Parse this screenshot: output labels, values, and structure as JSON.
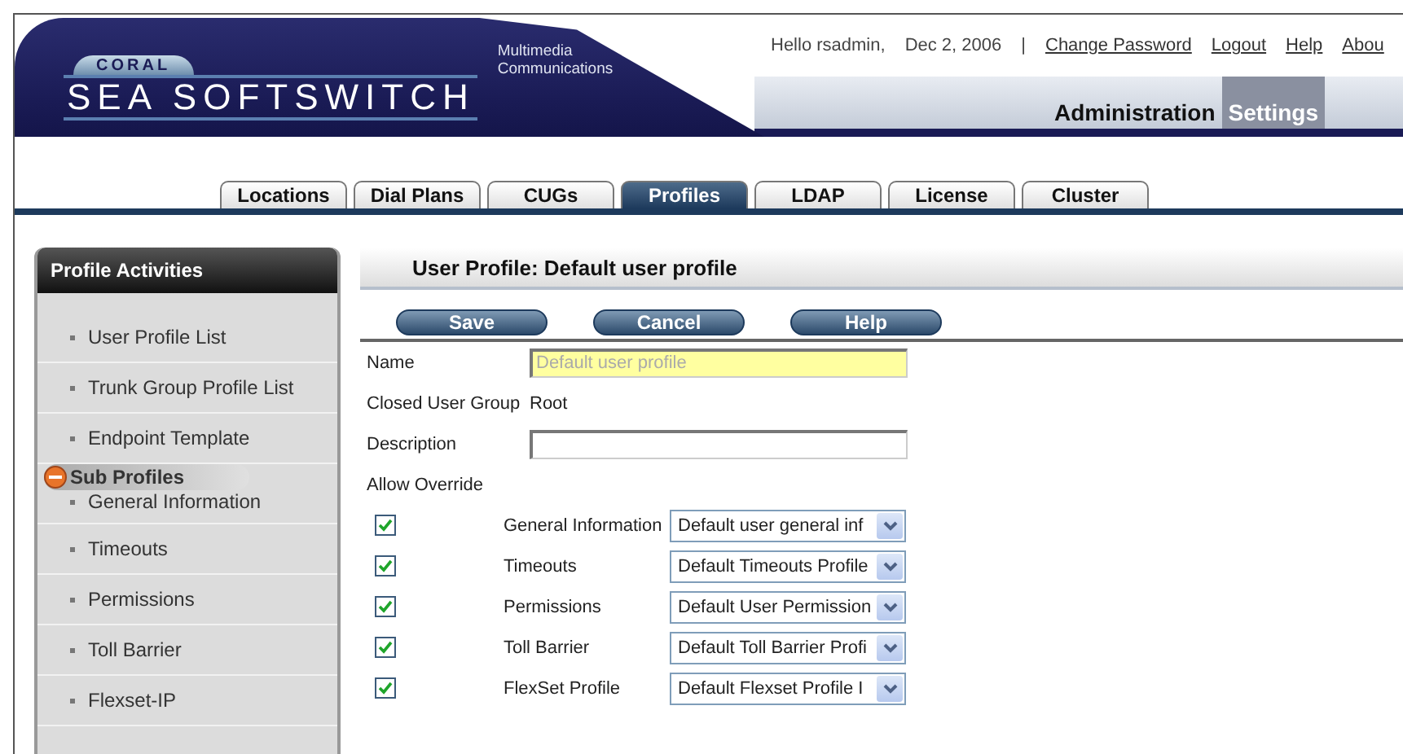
{
  "header": {
    "logo_top": "CORAL",
    "logo_main": "SEA SOFTSWITCH",
    "logo_sub": [
      "Multimedia",
      "Communications"
    ],
    "greeting": "Hello rsadmin,",
    "date": "Dec 2, 2006",
    "separator": "|",
    "links": [
      "Change Password",
      "Logout",
      "Help",
      "Abou"
    ],
    "nav": [
      {
        "label": "Administration",
        "selected": false
      },
      {
        "label": "Settings",
        "selected": true
      }
    ]
  },
  "tabs": [
    {
      "label": "Locations",
      "selected": false
    },
    {
      "label": "Dial Plans",
      "selected": false
    },
    {
      "label": "CUGs",
      "selected": false
    },
    {
      "label": "Profiles",
      "selected": true
    },
    {
      "label": "LDAP",
      "selected": false
    },
    {
      "label": "License",
      "selected": false
    },
    {
      "label": "Cluster",
      "selected": false
    }
  ],
  "sidebar": {
    "title": "Profile Activities",
    "items": [
      "User Profile List",
      "Trunk Group Profile List",
      "Endpoint Template"
    ],
    "sub_title": "Sub Profiles",
    "expanded": true,
    "sub_items": [
      "General Information",
      "Timeouts",
      "Permissions",
      "Toll Barrier",
      "Flexset-IP"
    ]
  },
  "form": {
    "title": "User Profile: Default user profile",
    "buttons": [
      "Save",
      "Cancel",
      "Help"
    ],
    "name": {
      "label": "Name",
      "value": "Default user profile",
      "disabled": true
    },
    "cug": {
      "label": "Closed User Group",
      "value": "Root"
    },
    "description": {
      "label": "Description"
    },
    "override_label": "Allow Override",
    "overrides": [
      {
        "checked": true,
        "label": "General Information",
        "value": "Default user general inf"
      },
      {
        "checked": true,
        "label": "Timeouts",
        "value": "Default Timeouts Profile"
      },
      {
        "checked": true,
        "label": "Permissions",
        "value": "Default User Permission"
      },
      {
        "checked": true,
        "label": "Toll Barrier",
        "value": "Default Toll Barrier Profi"
      },
      {
        "checked": true,
        "label": "FlexSet Profile",
        "value": "Default Flexset Profile I"
      }
    ]
  }
}
